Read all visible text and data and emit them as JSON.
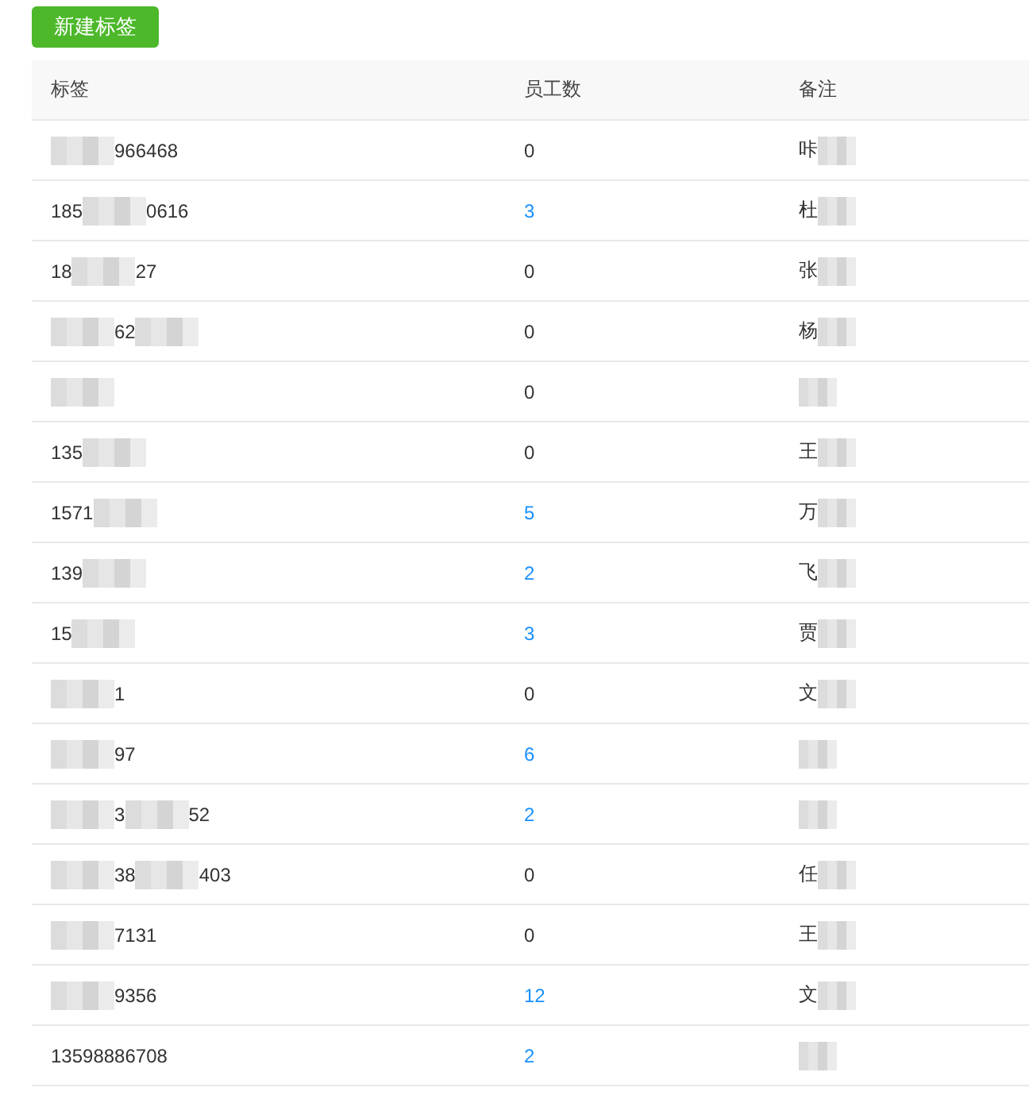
{
  "new_button": {
    "label": "新建标签"
  },
  "table": {
    "columns": [
      "标签",
      "员工数",
      "备注"
    ],
    "rows": [
      {
        "label": [
          {
            "kind": "mask"
          },
          {
            "kind": "text",
            "text": "966468"
          }
        ],
        "count": "0",
        "linked": false,
        "note": [
          {
            "kind": "text",
            "text": "咔"
          },
          {
            "kind": "mask"
          }
        ]
      },
      {
        "label": [
          {
            "kind": "text",
            "text": "185"
          },
          {
            "kind": "mask"
          },
          {
            "kind": "text",
            "text": "0616"
          }
        ],
        "count": "3",
        "linked": true,
        "note": [
          {
            "kind": "text",
            "text": "杜"
          },
          {
            "kind": "mask"
          }
        ]
      },
      {
        "label": [
          {
            "kind": "text",
            "text": "18"
          },
          {
            "kind": "mask"
          },
          {
            "kind": "text",
            "text": "27"
          }
        ],
        "count": "0",
        "linked": false,
        "note": [
          {
            "kind": "text",
            "text": "张"
          },
          {
            "kind": "mask"
          }
        ]
      },
      {
        "label": [
          {
            "kind": "mask"
          },
          {
            "kind": "text",
            "text": "62"
          },
          {
            "kind": "mask"
          }
        ],
        "count": "0",
        "linked": false,
        "note": [
          {
            "kind": "text",
            "text": "杨"
          },
          {
            "kind": "mask"
          }
        ]
      },
      {
        "label": [
          {
            "kind": "mask"
          }
        ],
        "count": "0",
        "linked": false,
        "note": [
          {
            "kind": "mask"
          }
        ]
      },
      {
        "label": [
          {
            "kind": "text",
            "text": "135"
          },
          {
            "kind": "mask"
          }
        ],
        "count": "0",
        "linked": false,
        "note": [
          {
            "kind": "text",
            "text": "王"
          },
          {
            "kind": "mask"
          }
        ]
      },
      {
        "label": [
          {
            "kind": "text",
            "text": "1571"
          },
          {
            "kind": "mask"
          }
        ],
        "count": "5",
        "linked": true,
        "note": [
          {
            "kind": "text",
            "text": "万"
          },
          {
            "kind": "mask"
          }
        ]
      },
      {
        "label": [
          {
            "kind": "text",
            "text": "139"
          },
          {
            "kind": "mask"
          }
        ],
        "count": "2",
        "linked": true,
        "note": [
          {
            "kind": "text",
            "text": "飞"
          },
          {
            "kind": "mask"
          }
        ]
      },
      {
        "label": [
          {
            "kind": "text",
            "text": "15"
          },
          {
            "kind": "mask"
          }
        ],
        "count": "3",
        "linked": true,
        "note": [
          {
            "kind": "text",
            "text": "贾"
          },
          {
            "kind": "mask"
          }
        ]
      },
      {
        "label": [
          {
            "kind": "mask"
          },
          {
            "kind": "text",
            "text": "1"
          }
        ],
        "count": "0",
        "linked": false,
        "note": [
          {
            "kind": "text",
            "text": "文"
          },
          {
            "kind": "mask"
          }
        ]
      },
      {
        "label": [
          {
            "kind": "mask"
          },
          {
            "kind": "text",
            "text": "97"
          }
        ],
        "count": "6",
        "linked": true,
        "note": [
          {
            "kind": "mask"
          }
        ]
      },
      {
        "label": [
          {
            "kind": "mask"
          },
          {
            "kind": "text",
            "text": "3"
          },
          {
            "kind": "mask"
          },
          {
            "kind": "text",
            "text": "52"
          }
        ],
        "count": "2",
        "linked": true,
        "note": [
          {
            "kind": "mask"
          }
        ]
      },
      {
        "label": [
          {
            "kind": "mask"
          },
          {
            "kind": "text",
            "text": "38"
          },
          {
            "kind": "mask"
          },
          {
            "kind": "text",
            "text": "403"
          }
        ],
        "count": "0",
        "linked": false,
        "note": [
          {
            "kind": "text",
            "text": "任"
          },
          {
            "kind": "mask"
          }
        ]
      },
      {
        "label": [
          {
            "kind": "mask"
          },
          {
            "kind": "text",
            "text": "7131"
          }
        ],
        "count": "0",
        "linked": false,
        "note": [
          {
            "kind": "text",
            "text": "王"
          },
          {
            "kind": "mask"
          }
        ]
      },
      {
        "label": [
          {
            "kind": "mask"
          },
          {
            "kind": "text",
            "text": "9356"
          }
        ],
        "count": "12",
        "linked": true,
        "note": [
          {
            "kind": "text",
            "text": "文"
          },
          {
            "kind": "mask"
          }
        ]
      },
      {
        "label": [
          {
            "kind": "text",
            "text": "13598886708"
          }
        ],
        "count": "2",
        "linked": true,
        "note": [
          {
            "kind": "mask"
          }
        ]
      }
    ]
  }
}
